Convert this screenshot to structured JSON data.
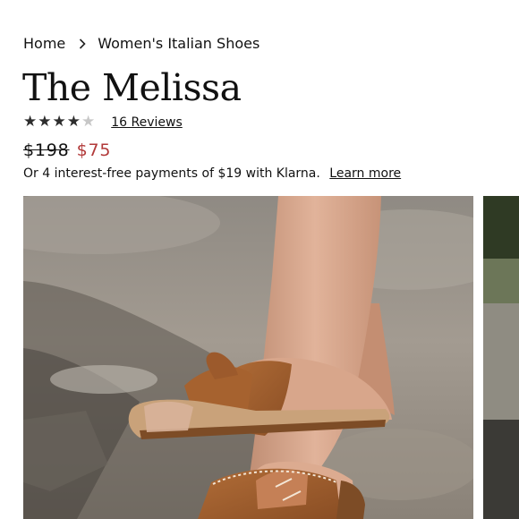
{
  "breadcrumb": {
    "home_label": "Home",
    "current_label": "Women's Italian Shoes"
  },
  "product": {
    "title": "The Melissa",
    "rating": 4,
    "rating_max": 5,
    "reviews_label": "16 Reviews",
    "original_price": "$198",
    "sale_price": "$75",
    "installment_text": "Or 4 interest-free payments of $19 with Klarna.",
    "learn_more_label": "Learn more"
  },
  "colors": {
    "sale_price": "#b23a3a",
    "star_filled": "#2d2d2d",
    "star_empty": "#c7c7c7",
    "sandal_leather": "#9a5b2e"
  },
  "icons": {
    "breadcrumb_separator": "chevron-right-icon",
    "rating": "star-icon"
  }
}
